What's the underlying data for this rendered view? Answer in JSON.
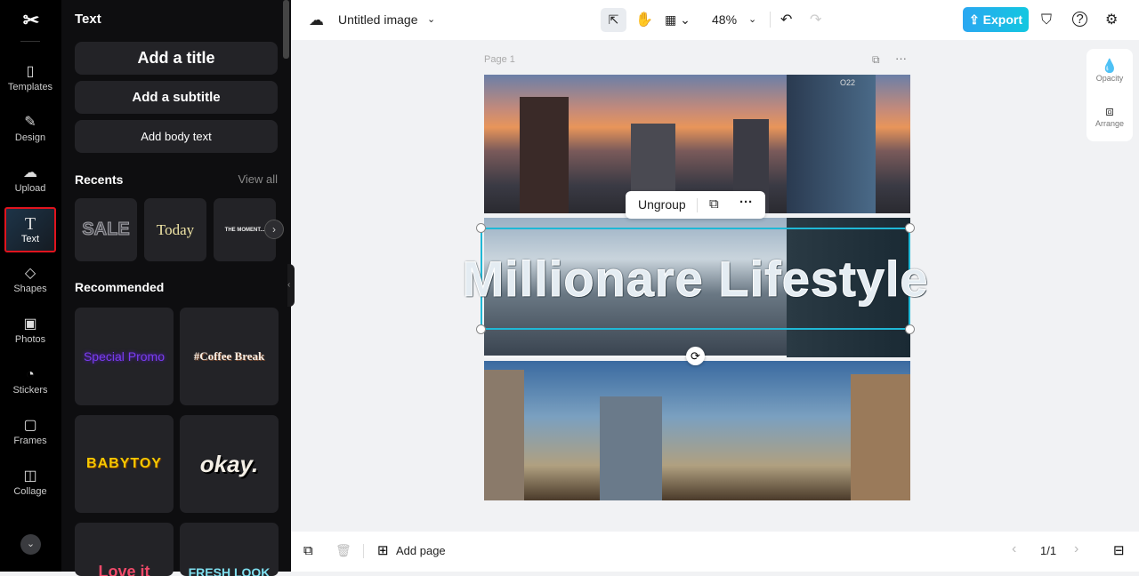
{
  "rail": {
    "items": [
      {
        "label": "Templates",
        "icon": "templates-icon"
      },
      {
        "label": "Design",
        "icon": "design-icon"
      },
      {
        "label": "Upload",
        "icon": "upload-icon"
      },
      {
        "label": "Text",
        "icon": "text-icon"
      },
      {
        "label": "Shapes",
        "icon": "shapes-icon"
      },
      {
        "label": "Photos",
        "icon": "photos-icon"
      },
      {
        "label": "Stickers",
        "icon": "stickers-icon"
      },
      {
        "label": "Frames",
        "icon": "frames-icon"
      },
      {
        "label": "Collage",
        "icon": "collage-icon"
      }
    ]
  },
  "panel": {
    "title": "Text",
    "add_title": "Add a title",
    "add_subtitle": "Add a subtitle",
    "add_body": "Add body text",
    "recents": "Recents",
    "view_all": "View all",
    "recent_items": [
      "SALE",
      "Today",
      "THE MOMENT..."
    ],
    "recommended": "Recommended",
    "recommended_items": [
      "Special Promo",
      "#Coffee Break",
      "BABYTOY",
      "okay.",
      "Love it",
      "FRESH LOOK"
    ]
  },
  "header": {
    "doc_title": "Untitled image",
    "zoom": "48%",
    "export": "Export"
  },
  "canvas": {
    "page_label": "Page 1",
    "text": "Millionare Lifestyle",
    "ungroup": "Ungroup",
    "watermark": "O22"
  },
  "side": {
    "opacity": "Opacity",
    "arrange": "Arrange"
  },
  "footer": {
    "add_page": "Add page",
    "page_count": "1/1"
  },
  "colors": {
    "accent": "#12c7e0",
    "selection": "#1fb8d6",
    "active_outline": "#e0141e"
  }
}
